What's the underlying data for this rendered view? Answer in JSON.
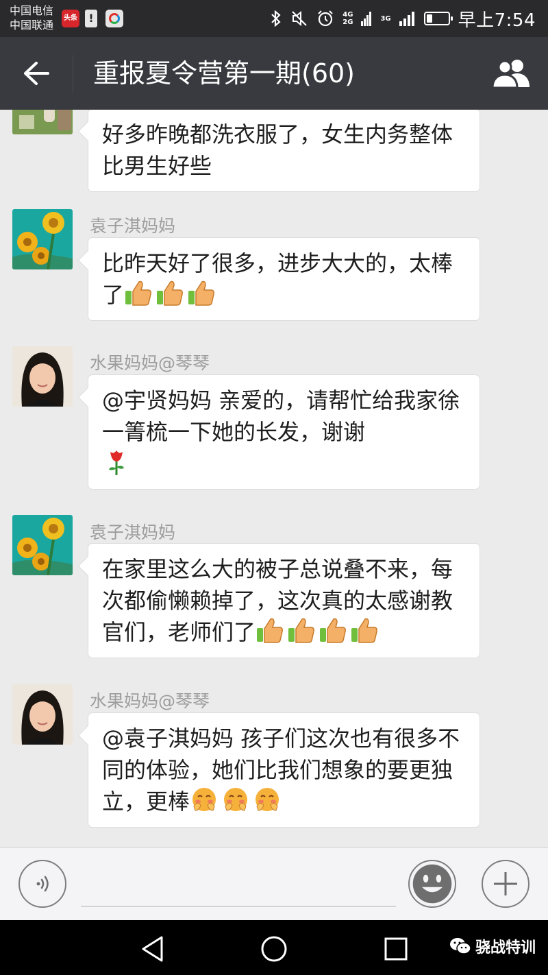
{
  "status_bar": {
    "carrier_1": "中国电信",
    "carrier_2": "中国联通",
    "news_badge": "头条",
    "alert_icon": "!",
    "net_4g": "4G",
    "net_2g": "2G",
    "net_3g": "3G",
    "battery_level": 0.25,
    "time": "早上7:54"
  },
  "header": {
    "title": "重报夏令营第一期(60)",
    "back_icon": "arrow-left",
    "members_icon": "group"
  },
  "messages": [
    {
      "sender": "",
      "avatar": "garden",
      "text": "好多昨晚都洗衣服了，女生内务整体比男生好些",
      "emojis": []
    },
    {
      "sender": "袁子淇妈妈",
      "avatar": "sunflower",
      "text": "比昨天好了很多，进步大大的，太棒了",
      "emojis": [
        "thumbs-up",
        "thumbs-up",
        "thumbs-up"
      ]
    },
    {
      "sender": "水果妈妈@琴琴",
      "avatar": "woman",
      "text": "@宇贤妈妈 亲爱的，请帮忙给我家徐一箐梳一下她的长发，谢谢",
      "emojis": [
        "rose"
      ]
    },
    {
      "sender": "袁子淇妈妈",
      "avatar": "sunflower",
      "text": "在家里这么大的被子总说叠不来，每次都偷懒赖掉了，这次真的太感谢教官们，老师们了",
      "emojis": [
        "thumbs-up",
        "thumbs-up",
        "thumbs-up",
        "thumbs-up"
      ]
    },
    {
      "sender": "水果妈妈@琴琴",
      "avatar": "woman",
      "text": "@袁子淇妈妈 孩子们这次也有很多不同的体验，她们比我们想象的要更独立，更棒",
      "emojis": [
        "shy-face",
        "shy-face",
        "shy-face"
      ]
    }
  ],
  "input_bar": {
    "placeholder": "",
    "voice_icon": "voice-wave",
    "emoji_icon": "smiley",
    "plus_icon": "plus"
  },
  "nav_bar": {
    "back_icon": "triangle-back",
    "home_icon": "circle-home",
    "recents_icon": "square-recents",
    "watermark": "骁战特训"
  },
  "colors": {
    "header_bg": "#393a3f",
    "status_bg": "#2a2a2c",
    "chat_bg": "#ebebeb",
    "bubble_bg": "#ffffff",
    "sender_text": "#9d9d9d"
  }
}
